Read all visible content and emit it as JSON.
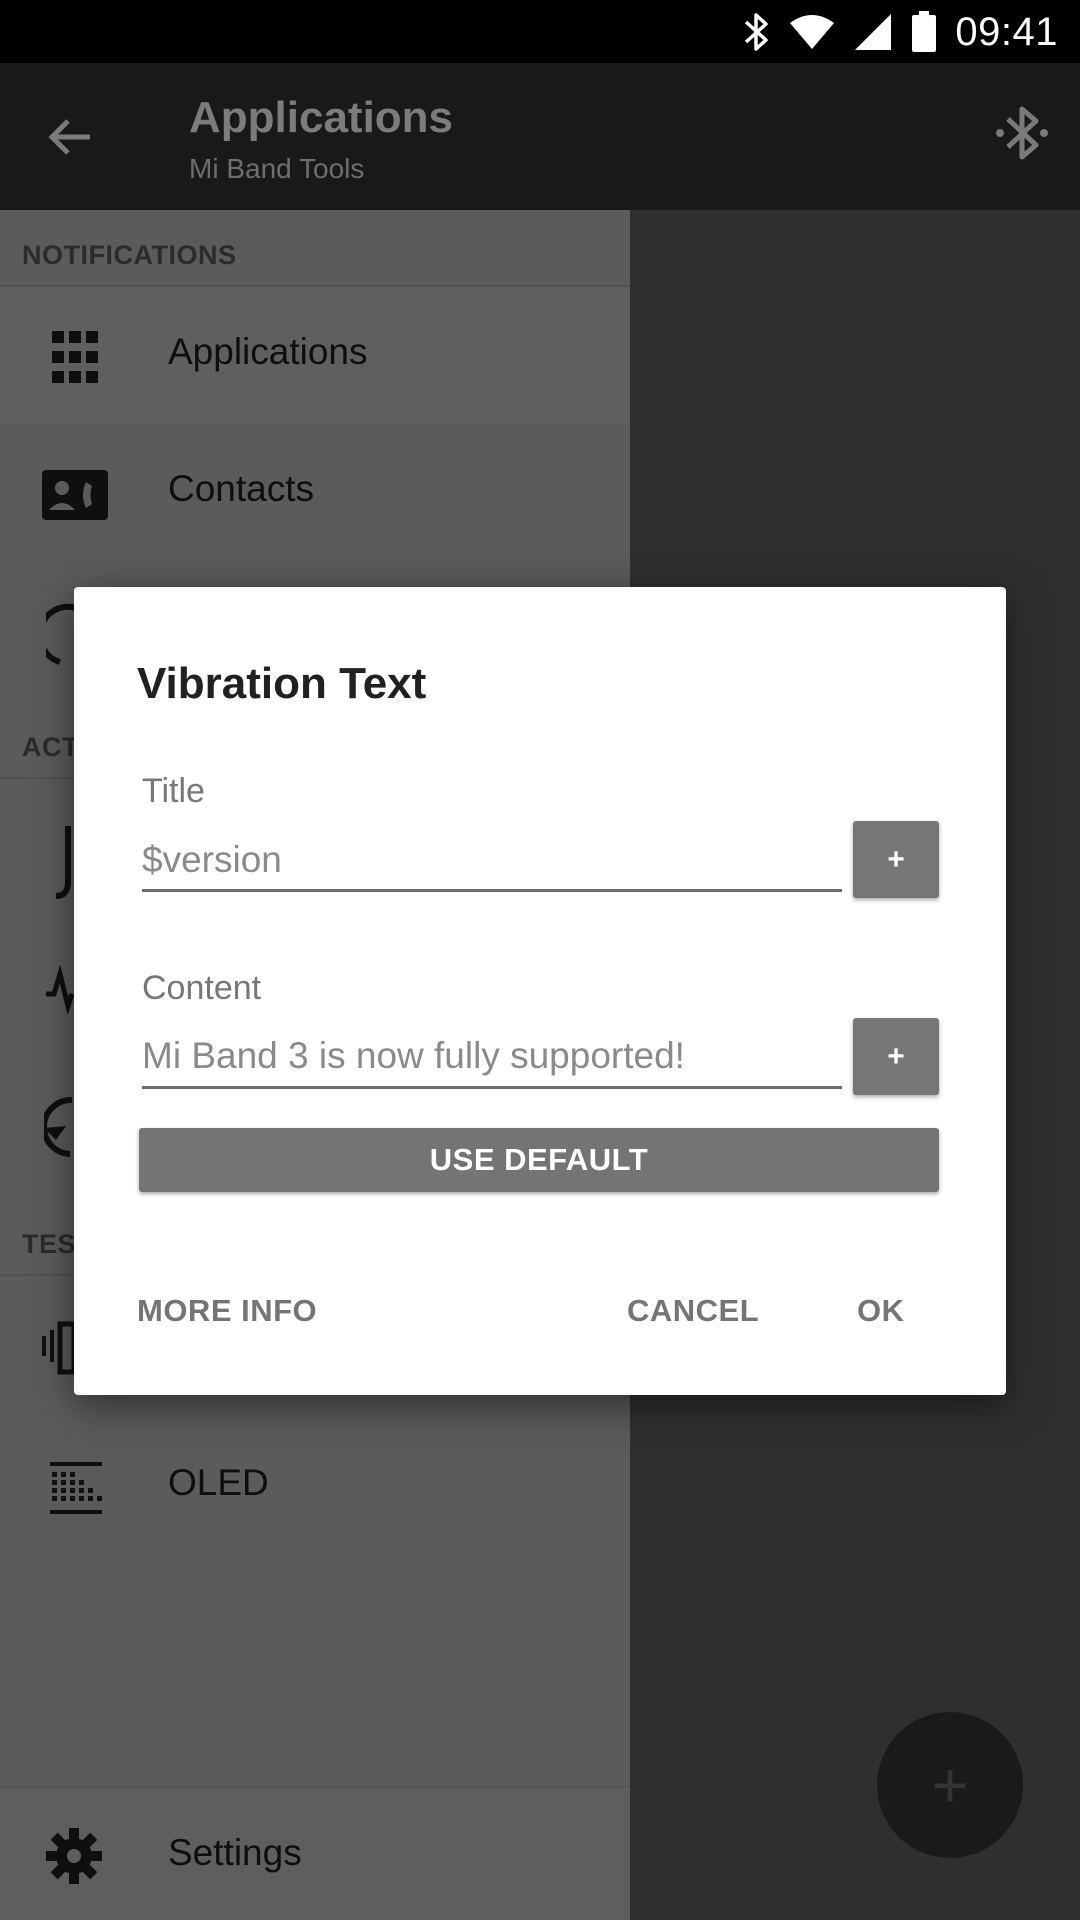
{
  "status_bar": {
    "time": "09:41",
    "icons": [
      "bluetooth-icon",
      "wifi-icon",
      "signal-icon",
      "battery-icon"
    ]
  },
  "app_bar": {
    "title": "Applications",
    "subtitle": "Mi Band Tools",
    "icons": [
      "back-arrow-icon",
      "bluetooth-searching-icon"
    ]
  },
  "drawer": {
    "section_notifications": "NOTIFICATIONS",
    "section_actions_visible": "ACT",
    "section_tests_visible": "TES",
    "items": [
      {
        "label": "Applications",
        "icon": "apps-grid-icon"
      },
      {
        "label": "Contacts",
        "icon": "contact-phone-icon"
      },
      {
        "label": "OLED",
        "icon": "dot-matrix-icon"
      },
      {
        "label": "Settings",
        "icon": "gear-icon"
      }
    ]
  },
  "dialog": {
    "title": "Vibration Text",
    "title_field": {
      "label": "Title",
      "value": "$version"
    },
    "content_field": {
      "label": "Content",
      "value": "Mi Band 3 is now fully supported!"
    },
    "plus_label": "+",
    "use_default_label": "USE DEFAULT",
    "more_info_label": "MORE INFO",
    "cancel_label": "CANCEL",
    "ok_label": "OK"
  },
  "fab": {
    "label": "+"
  },
  "colors": {
    "drawer_bg": "#5b5b5b",
    "scrim_right": "#2f2f2f",
    "appbar_bg": "#191919",
    "dialog_bg": "#ffffff",
    "button_grey": "#767676"
  }
}
